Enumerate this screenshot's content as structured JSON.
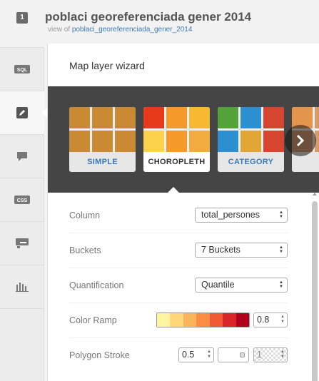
{
  "header": {
    "layer_number": "1",
    "title": "poblaci georeferenciada gener 2014",
    "view_of_prefix": "view of",
    "view_of_table": "poblaci_georeferenciada_gener_2014"
  },
  "sidebar": {
    "items": [
      {
        "name": "sql",
        "label": "SQL",
        "active": false
      },
      {
        "name": "wizard",
        "label": "",
        "active": true
      },
      {
        "name": "infowindow",
        "label": "",
        "active": false
      },
      {
        "name": "css",
        "label": "CSS",
        "active": false
      },
      {
        "name": "legends",
        "label": "",
        "active": false
      },
      {
        "name": "filters",
        "label": "",
        "active": false
      }
    ]
  },
  "panel": {
    "title": "Map layer wizard",
    "vis_types": [
      {
        "label": "SIMPLE",
        "selected": false,
        "colors": [
          "#c98a33",
          "#c98a33",
          "#c98a33",
          "#c98a33",
          "#c98a33",
          "#c98a33"
        ]
      },
      {
        "label": "CHOROPLETH",
        "selected": true,
        "colors": [
          "#e8391b",
          "#f4992a",
          "#f6b931",
          "#fcd24d",
          "#f4992a",
          "#f1ab3f"
        ]
      },
      {
        "label": "CATEGORY",
        "selected": false,
        "colors": [
          "#54a33a",
          "#2b8fd0",
          "#d5452f",
          "#2b8fd0",
          "#e2a637",
          "#d5452f"
        ]
      },
      {
        "label": "BU",
        "selected": false,
        "colors": [
          "#e5944c",
          "#d99a6a",
          "#d99a6a",
          "#d99a6a",
          "#d99a6a",
          "#d99a6a"
        ]
      }
    ]
  },
  "form": {
    "column": {
      "label": "Column",
      "value": "total_persones"
    },
    "buckets": {
      "label": "Buckets",
      "value": "7 Buckets"
    },
    "quantification": {
      "label": "Quantification",
      "value": "Quantile"
    },
    "color_ramp": {
      "label": "Color Ramp",
      "opacity": "0.8",
      "colors": [
        "#fff4a0",
        "#fdd77a",
        "#fcb45a",
        "#fa8c44",
        "#ef5a35",
        "#d9262a",
        "#b1001b"
      ]
    },
    "polygon_stroke": {
      "label": "Polygon Stroke",
      "width": "0.5",
      "opacity": "1"
    }
  }
}
